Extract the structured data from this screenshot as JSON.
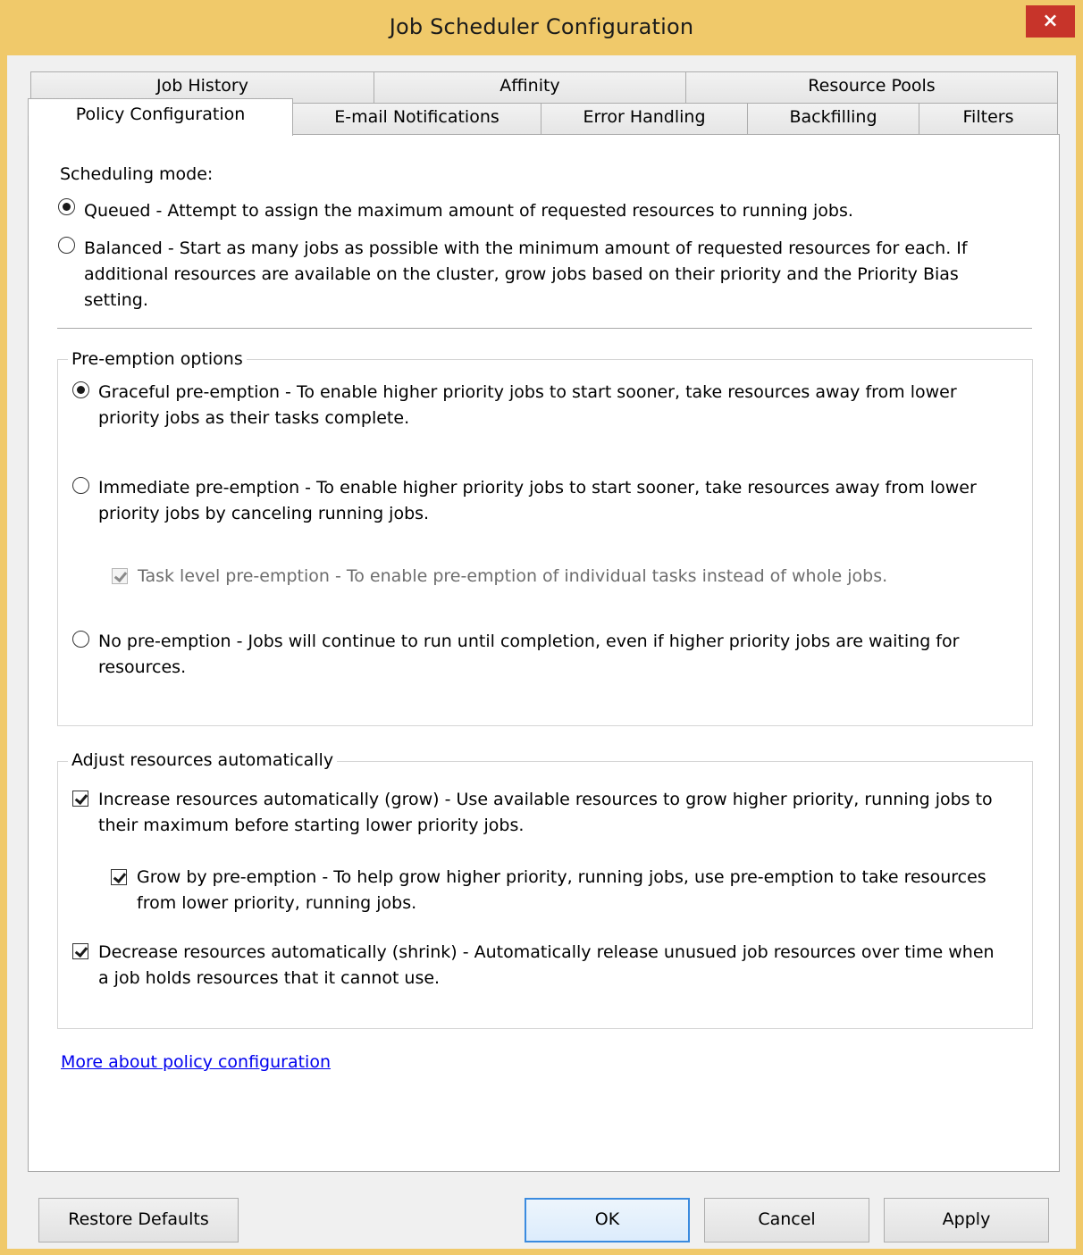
{
  "window": {
    "title": "Job Scheduler Configuration",
    "close_label": "×"
  },
  "tabs_top_row": [
    "Job History",
    "Affinity",
    "Resource Pools"
  ],
  "tabs_bottom_row": [
    "Policy Configuration",
    "E-mail Notifications",
    "Error Handling",
    "Backfilling",
    "Filters"
  ],
  "active_tab": "Policy Configuration",
  "scheduling": {
    "label": "Scheduling mode:",
    "queued": {
      "selected": true,
      "text": "Queued - Attempt to assign the maximum amount of requested resources to running jobs."
    },
    "balanced": {
      "selected": false,
      "line1": "Balanced - Start as many jobs as possible with the minimum amount of requested resources for each. If",
      "line2": "additional resources are available on the cluster, grow jobs based on their priority and the Priority Bias",
      "line3": "setting."
    }
  },
  "preemption": {
    "group_label": "Pre-emption options",
    "graceful": {
      "selected": true,
      "line1": "Graceful pre-emption - To enable higher priority jobs to start sooner, take resources away from lower",
      "line2": "priority jobs as their tasks complete."
    },
    "immediate": {
      "selected": false,
      "line1": "Immediate pre-emption - To enable higher priority jobs to start sooner, take resources away from lower",
      "line2": "priority jobs by canceling running jobs."
    },
    "task_level": {
      "checked": true,
      "enabled": false,
      "text": "Task level pre-emption - To enable pre-emption of individual tasks instead of whole jobs."
    },
    "none": {
      "selected": false,
      "line1": "No pre-emption - Jobs will continue to run until completion, even if higher priority jobs are waiting for",
      "line2": "resources."
    }
  },
  "adjust": {
    "group_label": "Adjust resources automatically",
    "grow": {
      "checked": true,
      "line1": "Increase resources automatically (grow) - Use available resources to grow higher priority, running jobs to",
      "line2": "their maximum before starting lower priority jobs."
    },
    "grow_preempt": {
      "checked": true,
      "line1": "Grow by pre-emption - To help grow higher priority, running jobs, use pre-emption to take resources",
      "line2": "from lower priority, running jobs."
    },
    "shrink": {
      "checked": true,
      "line1": "Decrease resources automatically (shrink) - Automatically release unusued job resources over time when",
      "line2": "a job holds resources that it cannot use."
    }
  },
  "more_link": "More about policy configuration",
  "buttons": {
    "restore": "Restore Defaults",
    "ok": "OK",
    "cancel": "Cancel",
    "apply": "Apply"
  }
}
